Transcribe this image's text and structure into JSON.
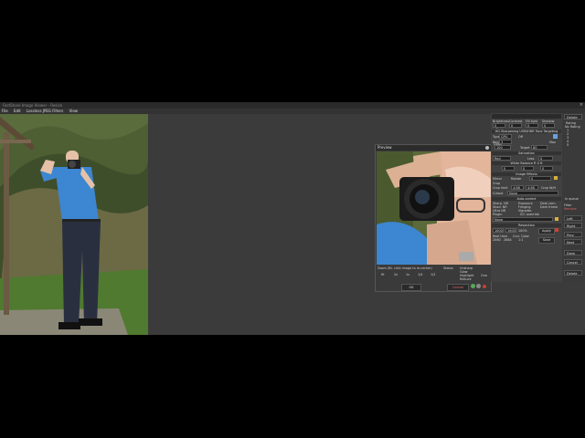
{
  "window": {
    "title": "FastStone Image Viewer - Resize"
  },
  "menu": [
    "File",
    "Edit",
    "Lossless JPEG Filters",
    "View"
  ],
  "preview": {
    "title": "Preview",
    "zoom_label": "Zoom (Rt. click image to re-center)",
    "zoom_levels": [
      "fit",
      "2x",
      "1x",
      "1/4",
      "1/2"
    ],
    "status": "Status",
    "options": [
      "Unsharp",
      "Glow",
      "Highlight",
      "Reduce"
    ],
    "one_label": "One",
    "ok_button": "OK",
    "cancel_button": "Cancel"
  },
  "side_panel": {
    "tabs": [
      "Adjust",
      "Levels",
      "Curves",
      "Ink",
      "Color"
    ],
    "row_top": [
      "Brightness",
      "Contrast",
      "Fill light",
      "Shadow"
    ],
    "sharpen_label": "HG Sharpening",
    "hdr_label": "USM/HDR Tone Targeting",
    "type_label": "Type",
    "type_value": "GPU",
    "rad_label": "Rad",
    "off_label": "Off",
    "max_label": "Max",
    "target_label": "Target",
    "target_value": "80",
    "field_100": "100",
    "field_3": "3",
    "field_0": "0",
    "saturation_label": "Saturation",
    "red_label": "Red",
    "less_label": "Less",
    "white_balance": "White Balance",
    "rgb_label": "R G B",
    "image_effects": "Image Effects",
    "mirror_label": "Mirror",
    "crop_label": "Crop",
    "crop_limit": "Crop limit",
    "cutout": "Cutout",
    "none": "None",
    "rotate_label": "Rotate",
    "aspect_v1": "4:66",
    "aspect_v2": "4:66",
    "crop_wh": "Crop W/H",
    "auto_correct": "Auto-correct",
    "sharp_nr": "Sharp. NR",
    "shad_nr": "Shad. NR",
    "ultra_nr": "Ultra NR",
    "exposure": "Exposure",
    "fringing": "Fringing",
    "vignette": "Vignette",
    "dark_corn": "Dark corn.",
    "dark_frame": "Dark frame",
    "plugin": "Plugin",
    "icc_override": "ICC override",
    "resolution": "Resolution",
    "res_w": "1600",
    "res_h": "1600",
    "res_pct": "100%",
    "real_time": "Real time",
    "curr_color": "Curr. Color",
    "apply": "Apply",
    "save": "Save",
    "zoom_w": "2060",
    "zoom_h": "2684",
    "exif_value": "1:1"
  },
  "far_panel": {
    "delete_top": "Delete",
    "rating_label": "Rating",
    "no_rating": "No Rating",
    "ratings": [
      "1",
      "2",
      "3",
      "4",
      "5"
    ],
    "in_queue": "In queue",
    "filter_label": "Filter",
    "filter_value": "Remove",
    "left": "Left",
    "right": "Right",
    "prev": "Prev",
    "next": "Next",
    "done": "Done",
    "cancel": "Cancel",
    "delete": "Delete"
  },
  "colors": {
    "app_bg": "#3b3b3b",
    "shirt_blue": "#3d86d1",
    "panel_bg": "#414141",
    "accent_red": "#c9412f"
  }
}
